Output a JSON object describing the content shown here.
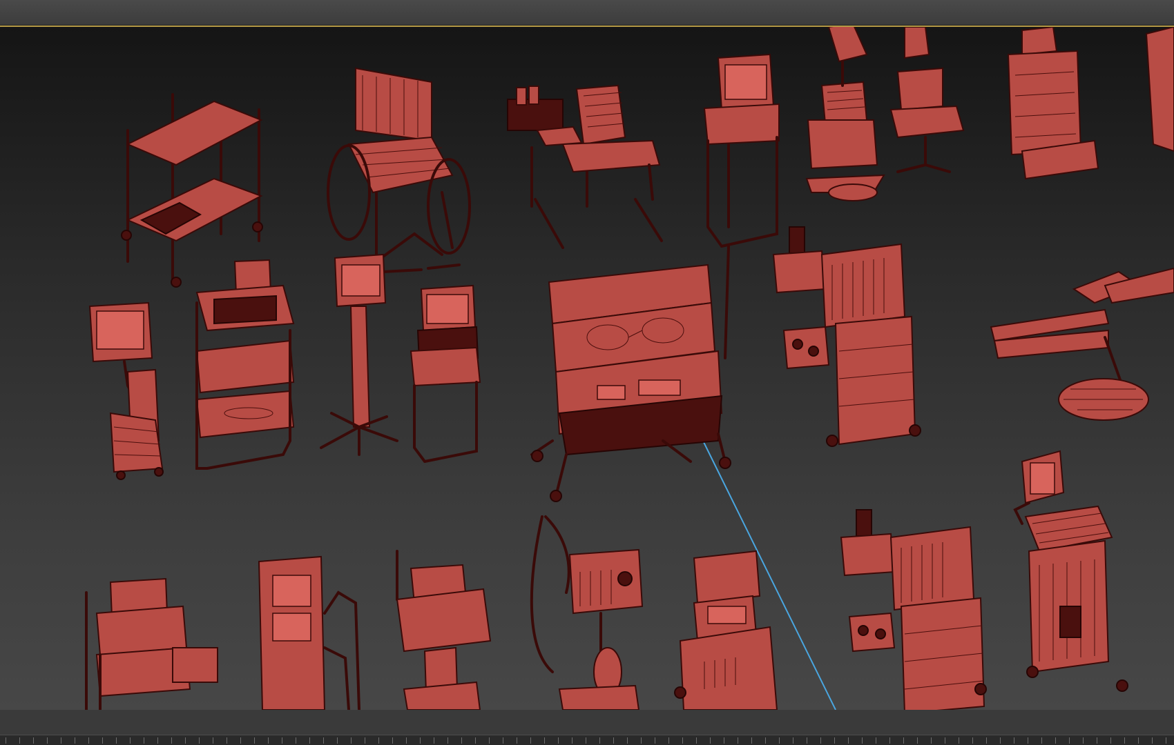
{
  "colors": {
    "mesh_fill": "#b84c45",
    "mesh_wire": "#3a0a08",
    "viewport_border": "#b59a45",
    "guide_line": "#4aa6e0"
  },
  "viewport": {
    "kind": "3d-wireframe-viewport",
    "objects": [
      "instrument-cart",
      "wheelchair",
      "iv-armchair",
      "monitor-stand-tall",
      "surgical-light-arm-top",
      "monitor-trolley",
      "endoscopy-tower",
      "patient-monitor-on-stand",
      "iv-pole-monitor",
      "compact-monitor-cart",
      "infant-incubator",
      "anesthesia-machine",
      "surgical-lamp-arm",
      "stacked-equipment-cart",
      "gas-column",
      "small-device-cart",
      "ventilator",
      "ultrasound-console",
      "anesthesia-machine-2",
      "ultrasound-station"
    ]
  }
}
